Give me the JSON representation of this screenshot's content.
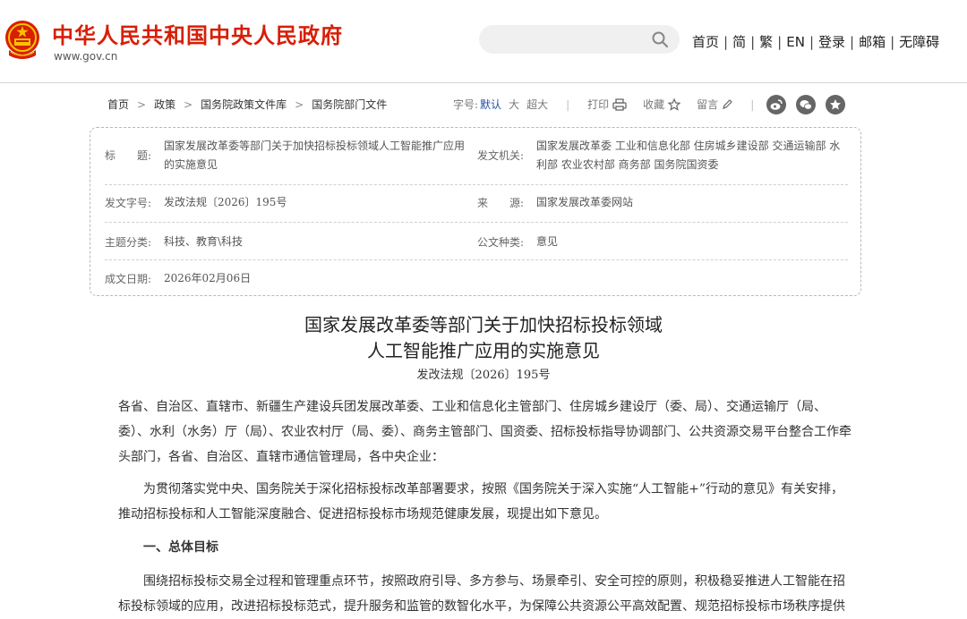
{
  "header": {
    "site_title": "中华人民共和国中央人民政府",
    "site_url": "www.gov.cn",
    "search_placeholder": "",
    "nav": {
      "home": "首页",
      "simplified": "简",
      "traditional": "繁",
      "english": "EN",
      "login": "登录",
      "mail": "邮箱",
      "accessibility": "无障碍"
    },
    "separator": "|"
  },
  "breadcrumb": {
    "items": [
      "首页",
      "政策",
      "国务院政策文件库",
      "国务院部门文件"
    ],
    "arrow": ">"
  },
  "tools": {
    "font_size_label": "字号:",
    "font_default": "默认",
    "font_large": "大",
    "font_xlarge": "超大",
    "print": "打印",
    "favorite": "收藏",
    "comment": "留言",
    "separator": "|"
  },
  "colors": {
    "brand_red": "#d81e06",
    "active_blue": "#1f4ea8"
  },
  "meta": {
    "title_label": "标　　题:",
    "title_value": "国家发展改革委等部门关于加快招标投标领域人工智能推广应用的实施意见",
    "issuer_label": "发文机关:",
    "issuer_value": "国家发展改革委 工业和信息化部 住房城乡建设部 交通运输部 水利部 农业农村部 商务部 国务院国资委",
    "doc_no_label": "发文字号:",
    "doc_no_value": "发改法规〔2026〕195号",
    "source_label": "来　　源:",
    "source_value": "国家发展改革委网站",
    "topic_label": "主题分类:",
    "topic_value": "科技、教育\\科技",
    "type_label": "公文种类:",
    "type_value": "意见",
    "date_label": "成文日期:",
    "date_value": "2026年02月06日"
  },
  "document": {
    "title_line1": "国家发展改革委等部门关于加快招标投标领域",
    "title_line2": "人工智能推广应用的实施意见",
    "number": "发改法规〔2026〕195号",
    "addressee": "各省、自治区、直辖市、新疆生产建设兵团发展改革委、工业和信息化主管部门、住房城乡建设厅（委、局）、交通运输厅（局、委）、水利（水务）厅（局）、农业农村厅（局、委）、商务主管部门、国资委、招标投标指导协调部门、公共资源交易平台整合工作牵头部门，各省、自治区、直辖市通信管理局，各中央企业：",
    "intro": "为贯彻落实党中央、国务院关于深化招标投标改革部署要求，按照《国务院关于深入实施“人工智能+”行动的意见》有关安排，推动招标投标和人工智能深度融合、促进招标投标市场规范健康发展，现提出如下意见。",
    "section1_heading": "一、总体目标",
    "section1_para": "围绕招标投标交易全过程和管理重点环节，按照政府引导、多方参与、场景牵引、安全可控的原则，积极稳妥推进人工智能在招标投标领域的应用，改进招标投标范式，提升服务和监管的数智化水平，为保障公共资源公平高效配置、规范招标投标市场秩序提供"
  }
}
